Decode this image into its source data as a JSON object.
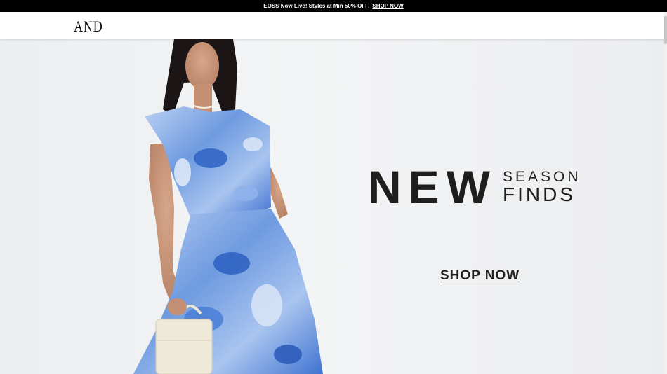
{
  "announcement": {
    "text": "EOSS Now Live! Styles at Min 50% OFF.",
    "link_label": "SHOP NOW"
  },
  "header": {
    "logo": "AND"
  },
  "hero": {
    "headline_big": "NEW",
    "headline_small_1": "SEASON",
    "headline_small_2": "FINDS",
    "cta_label": "SHOP NOW",
    "colors": {
      "background": "#eceef1",
      "dress_primary": "#3f73d1",
      "text": "#1e1e1e"
    }
  }
}
